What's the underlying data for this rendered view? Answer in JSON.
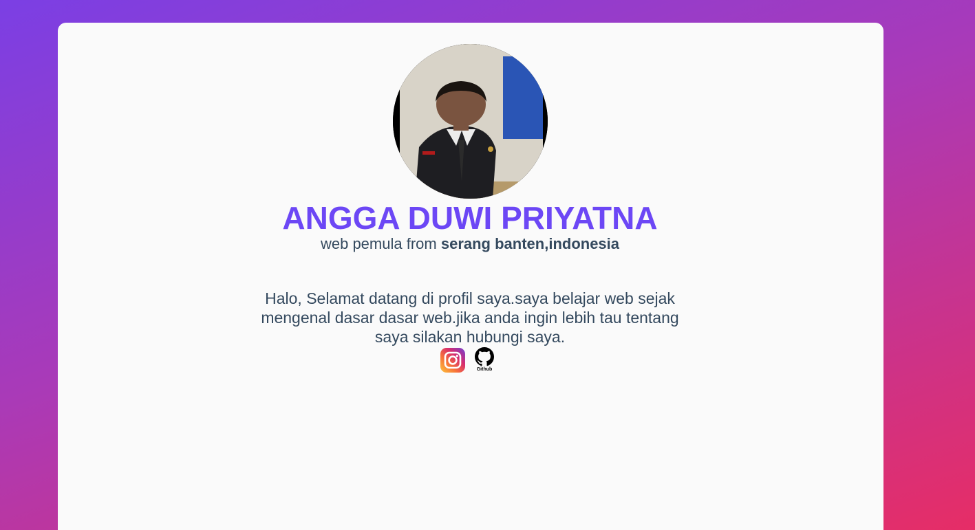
{
  "profile": {
    "name": "ANGGA DUWI PRIYATNA",
    "tagline_prefix": "web pemula from",
    "tagline_location": "serang banten,indonesia",
    "bio": "Halo, Selamat datang di profil saya.saya belajar web sejak mengenal dasar dasar web.jika anda ingin lebih tau tentang saya silakan hubungi saya."
  },
  "socials": [
    {
      "name": "Instagram",
      "icon": "instagram-icon"
    },
    {
      "name": "Github",
      "icon": "github-icon",
      "label": "Github"
    }
  ],
  "colors": {
    "name": "#6c47f5",
    "text": "#34495e",
    "card": "#fafafa",
    "background_start": "#7b3fe4",
    "background_end": "#e62d66"
  }
}
